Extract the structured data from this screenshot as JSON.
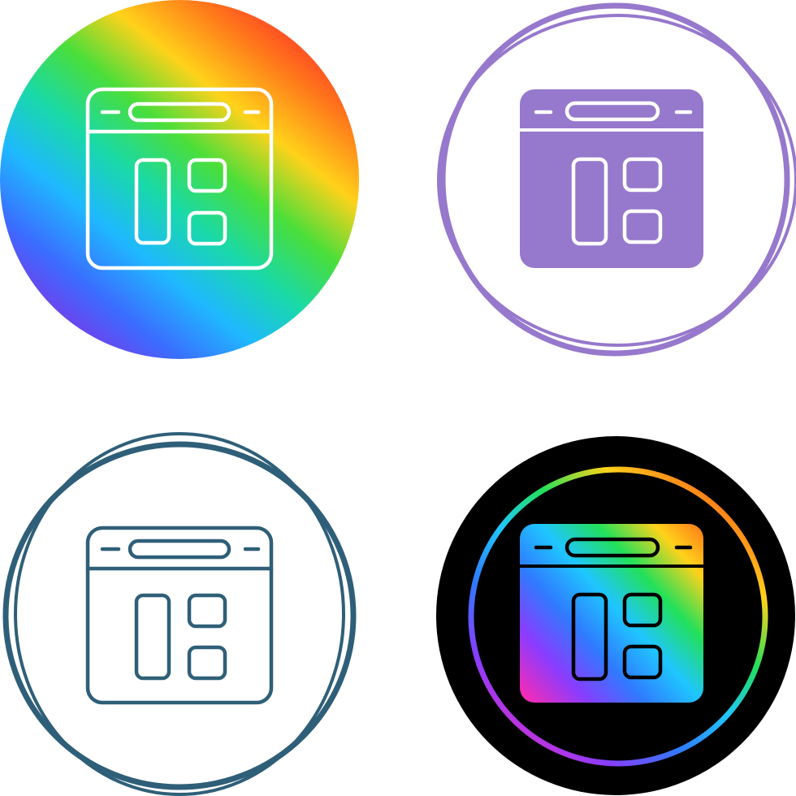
{
  "icon_set": {
    "subject": "browser-window-dashboard-layout",
    "variants": [
      {
        "style": "gradient-circle-outline",
        "icon": "browser-layout-icon"
      },
      {
        "style": "purple-ring-glyph",
        "icon": "browser-layout-icon"
      },
      {
        "style": "teal-ring-outline",
        "icon": "browser-layout-icon"
      },
      {
        "style": "black-circle-gradient-glyph",
        "icon": "browser-layout-icon"
      }
    ]
  },
  "colors": {
    "background": "#ffffff",
    "purple": "#9678cc",
    "teal": "#2f5f78",
    "black": "#000000",
    "white": "#ffffff",
    "rainbow": [
      "#8a2be2",
      "#3b6cff",
      "#1fb8ff",
      "#19d9a8",
      "#4ade3a",
      "#ffd21a",
      "#ff7a1a",
      "#ff2a2a"
    ],
    "rainbow_dark": [
      "#ff2ab0",
      "#8a3cff",
      "#2f7bff",
      "#1fc6ff",
      "#22e05a",
      "#ffd21a",
      "#ff5a1a"
    ]
  }
}
